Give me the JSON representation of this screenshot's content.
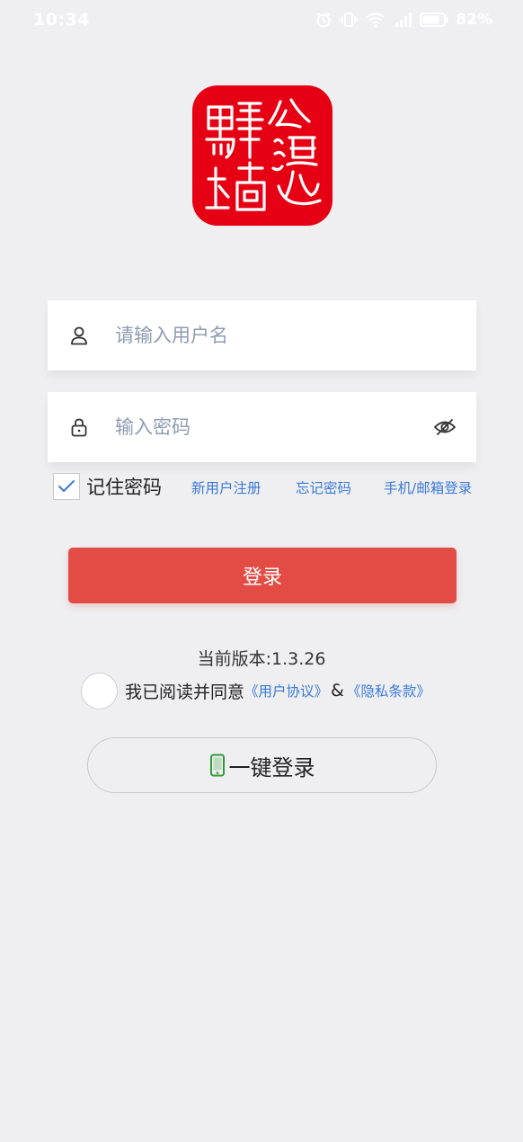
{
  "status_bar": {
    "time": "10:34",
    "battery_percent": "82%",
    "icons": [
      "alarm-icon",
      "vibrate-icon",
      "wifi-icon",
      "cellular-signal-icon",
      "battery-icon"
    ],
    "battery_level": 0.82
  },
  "logo": {
    "icon": "seal-logo-icon",
    "background_color": "#e60013"
  },
  "form": {
    "username": {
      "icon": "user-icon",
      "placeholder": "请输入用户名",
      "value": ""
    },
    "password": {
      "icon": "lock-icon",
      "placeholder": "输入密码",
      "value": "",
      "toggle_icon": "eye-hidden-icon"
    },
    "remember": {
      "label": "记住密码",
      "checked": true
    },
    "links": {
      "register": "新用户注册",
      "forgot": "忘记密码",
      "phone_email": "手机/邮箱登录"
    },
    "login_button": "登录"
  },
  "version": "当前版本:1.3.26",
  "agreement": {
    "text": "我已阅读并同意",
    "user_agreement": "《用户协议》",
    "ampersand": "&",
    "privacy_policy": "《隐私条款》",
    "checked": false
  },
  "one_key_login": {
    "icon": "phone-icon",
    "label": "一键登录"
  },
  "colors": {
    "background": "#efeff1",
    "primary_button": "#e34b45",
    "link": "#3b7ad6",
    "placeholder": "#8e9bb3",
    "phone_icon": "#2e9b35"
  }
}
